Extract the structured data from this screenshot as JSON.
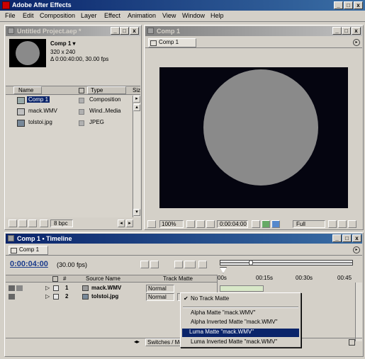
{
  "app": {
    "title": "Adobe After Effects"
  },
  "menu": [
    "File",
    "Edit",
    "Composition",
    "Layer",
    "Effect",
    "Animation",
    "View",
    "Window",
    "Help"
  ],
  "project": {
    "title": "Untitled Project.aep *",
    "comp_name": "Comp 1 ▾",
    "comp_size": "320 x 240",
    "comp_duration": "Δ 0:00:40:00, 30.00 fps",
    "columns": [
      "Name",
      "Type",
      "Size"
    ],
    "items": [
      {
        "name": "Comp 1",
        "type": "Composition"
      },
      {
        "name": "mack.WMV",
        "type": "Wind..Media"
      },
      {
        "name": "tolstoi.jpg",
        "type": "JPEG"
      }
    ],
    "bpc": "8 bpc"
  },
  "comp_window": {
    "title": "Comp 1",
    "tab": "Comp 1",
    "zoom": "100%",
    "timecode": "0:00:04:00",
    "resolution": "Full"
  },
  "timeline": {
    "title": "Comp 1 • Timeline",
    "tab": "Comp 1",
    "timecode": "0:00:04:00",
    "fps": "(30.00 fps)",
    "columns": {
      "num": "#",
      "source": "Source Name",
      "matte": "Track Matte"
    },
    "ruler": [
      "00s",
      "00:15s",
      "00:30s",
      "00:45"
    ],
    "layers": [
      {
        "num": "1",
        "name": "mack.WMV",
        "mode": "Normal"
      },
      {
        "num": "2",
        "name": "tolstoi.jpg",
        "mode": "Normal"
      }
    ],
    "footer": "Switches / Modes"
  },
  "dropdown": {
    "items": [
      {
        "label": "No Track Matte",
        "checked": true,
        "highlighted": false
      },
      {
        "label": "Alpha Matte \"mack.WMV\"",
        "checked": false,
        "highlighted": false
      },
      {
        "label": "Alpha Inverted Matte \"mack.WMV\"",
        "checked": false,
        "highlighted": false
      },
      {
        "label": "Luma Matte \"mack.WMV\"",
        "checked": false,
        "highlighted": true
      },
      {
        "label": "Luma Inverted Matte \"mack.WMV\"",
        "checked": false,
        "highlighted": false
      }
    ],
    "check_glyph": "✔"
  },
  "colors": {
    "title_active": "#0a246a",
    "highlight": "#0a246a",
    "viewer_bg": "#050510",
    "circle": "#8a8a8a"
  }
}
